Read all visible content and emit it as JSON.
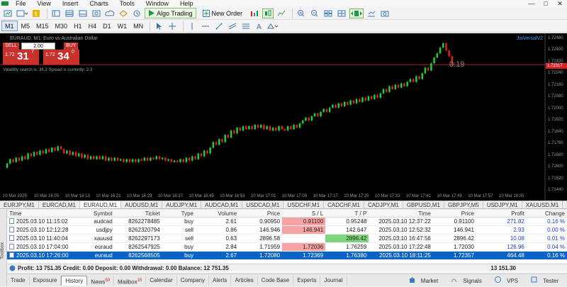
{
  "menu": {
    "items": [
      "File",
      "View",
      "Insert",
      "Charts",
      "Tools",
      "Window",
      "Help"
    ],
    "win_min": "—",
    "win_max": "□",
    "win_close": "✕"
  },
  "toolbar": {
    "algo_label": "Algo Trading",
    "new_order_label": "New Order"
  },
  "timeframes": {
    "items": [
      "M1",
      "M5",
      "M15",
      "M30",
      "H1",
      "H4",
      "D1",
      "W1",
      "MN"
    ],
    "active": "M1"
  },
  "chart": {
    "title": "EURAUD, M1:  Euro vs Australian Dollar",
    "indicator": "JoiVersalV2",
    "sell_label": "SELL",
    "buy_label": "BUY",
    "volume": "2.00",
    "sell_price_prefix": "1.72",
    "sell_price_big": "31",
    "sell_price_sup": "7",
    "buy_price_prefix": "1.72",
    "buy_price_big": "34",
    "buy_price_sup": "0",
    "info": "Volatility search is: 36.2  Spread is currently: 2.3",
    "countdown": "0:19",
    "current_price": "1.72317",
    "price_labels": [
      "1.72480",
      "1.72400",
      "1.72320",
      "1.72240",
      "1.72160",
      "1.72080",
      "1.72000",
      "1.71920",
      "1.71840",
      "1.71760",
      "1.71680",
      "1.71600",
      "1.71520",
      "1.71440"
    ],
    "time_labels": [
      "10 Mar 2025",
      "10 Mar 16:05",
      "10 Mar 16:13",
      "10 Mar 16:21",
      "10 Mar 16:29",
      "10 Mar 16:37",
      "10 Mar 16:45",
      "10 Mar 16:53",
      "10 Mar 17:01",
      "10 Mar 17:09",
      "10 Mar 17:17",
      "10 Mar 17:25",
      "10 Mar 17:33",
      "10 Mar 17:41",
      "10 Mar 17:49",
      "10 Mar 17:57",
      "10 Mar 18:05"
    ],
    "colors": {
      "bull": "#19d13a",
      "bear": "#e0201c",
      "background": "#000000",
      "bid_line": "#d22020"
    }
  },
  "chart_data": {
    "type": "candlestick",
    "ylim": [
      1.7144,
      1.7252
    ],
    "candles": [
      [
        1.716,
        1.7163
      ],
      [
        1.7163,
        1.7166
      ],
      [
        1.7166,
        1.7164
      ],
      [
        1.7164,
        1.7167
      ],
      [
        1.7167,
        1.7165
      ],
      [
        1.7165,
        1.7168
      ],
      [
        1.7168,
        1.7166
      ],
      [
        1.7166,
        1.717
      ],
      [
        1.717,
        1.7168
      ],
      [
        1.7168,
        1.7171
      ],
      [
        1.7171,
        1.7169
      ],
      [
        1.7169,
        1.7172
      ],
      [
        1.7172,
        1.717
      ],
      [
        1.717,
        1.7173
      ],
      [
        1.7173,
        1.7171
      ],
      [
        1.7171,
        1.7174
      ],
      [
        1.7174,
        1.7172
      ],
      [
        1.7172,
        1.7175
      ],
      [
        1.7175,
        1.7173
      ],
      [
        1.7173,
        1.717
      ],
      [
        1.717,
        1.7172
      ],
      [
        1.7172,
        1.7169
      ],
      [
        1.7169,
        1.7171
      ],
      [
        1.7171,
        1.7168
      ],
      [
        1.7168,
        1.717
      ],
      [
        1.717,
        1.7167
      ],
      [
        1.7167,
        1.7169
      ],
      [
        1.7169,
        1.7166
      ],
      [
        1.7166,
        1.7168
      ],
      [
        1.7168,
        1.7166
      ],
      [
        1.7166,
        1.7168
      ],
      [
        1.7168,
        1.7166
      ],
      [
        1.7166,
        1.7168
      ],
      [
        1.7168,
        1.7165
      ],
      [
        1.7165,
        1.7167
      ],
      [
        1.7167,
        1.7165
      ],
      [
        1.7165,
        1.7167
      ],
      [
        1.7167,
        1.7165
      ],
      [
        1.7165,
        1.7166
      ],
      [
        1.7166,
        1.7164
      ],
      [
        1.7164,
        1.7166
      ],
      [
        1.7166,
        1.7164
      ],
      [
        1.7164,
        1.7166
      ],
      [
        1.7166,
        1.7164
      ],
      [
        1.7164,
        1.7166
      ],
      [
        1.7166,
        1.7165
      ],
      [
        1.7165,
        1.7167
      ],
      [
        1.7167,
        1.7165
      ],
      [
        1.7165,
        1.7167
      ],
      [
        1.7167,
        1.7166
      ],
      [
        1.7166,
        1.7168
      ],
      [
        1.7168,
        1.7166
      ],
      [
        1.7166,
        1.7167
      ],
      [
        1.7167,
        1.7165
      ],
      [
        1.7165,
        1.7166
      ],
      [
        1.7166,
        1.7164
      ],
      [
        1.7164,
        1.7165
      ],
      [
        1.7165,
        1.7164
      ],
      [
        1.7164,
        1.7166
      ],
      [
        1.7166,
        1.7164
      ],
      [
        1.7164,
        1.7167
      ],
      [
        1.7167,
        1.7165
      ],
      [
        1.7165,
        1.7168
      ],
      [
        1.7168,
        1.7166
      ],
      [
        1.7166,
        1.717
      ],
      [
        1.717,
        1.7168
      ],
      [
        1.7168,
        1.7172
      ],
      [
        1.7172,
        1.717
      ],
      [
        1.717,
        1.7174
      ],
      [
        1.7174,
        1.7178
      ],
      [
        1.7178,
        1.7176
      ],
      [
        1.7176,
        1.718
      ],
      [
        1.718,
        1.7178
      ],
      [
        1.7178,
        1.7183
      ],
      [
        1.7183,
        1.7181
      ],
      [
        1.7181,
        1.7186
      ],
      [
        1.7186,
        1.7184
      ],
      [
        1.7184,
        1.7188
      ],
      [
        1.7188,
        1.7186
      ],
      [
        1.7186,
        1.7189
      ],
      [
        1.7189,
        1.7187
      ],
      [
        1.7187,
        1.7189
      ],
      [
        1.7189,
        1.7187
      ],
      [
        1.7187,
        1.719
      ],
      [
        1.719,
        1.7188
      ],
      [
        1.7188,
        1.719
      ],
      [
        1.719,
        1.7187
      ],
      [
        1.7187,
        1.7189
      ],
      [
        1.7189,
        1.7186
      ],
      [
        1.7186,
        1.7188
      ],
      [
        1.7188,
        1.7186
      ],
      [
        1.7186,
        1.7189
      ],
      [
        1.7189,
        1.7187
      ],
      [
        1.7187,
        1.7186
      ],
      [
        1.7186,
        1.7189
      ],
      [
        1.7189,
        1.7187
      ],
      [
        1.7187,
        1.719
      ],
      [
        1.719,
        1.7188
      ],
      [
        1.7188,
        1.7191
      ],
      [
        1.7191,
        1.7193
      ],
      [
        1.7193,
        1.7195
      ],
      [
        1.7195,
        1.7193
      ],
      [
        1.7193,
        1.7196
      ],
      [
        1.7196,
        1.7198
      ],
      [
        1.7198,
        1.7196
      ],
      [
        1.7196,
        1.7199
      ],
      [
        1.7199,
        1.7201
      ],
      [
        1.7201,
        1.7199
      ],
      [
        1.7199,
        1.7202
      ],
      [
        1.7202,
        1.7204
      ],
      [
        1.7204,
        1.7202
      ],
      [
        1.7202,
        1.7205
      ],
      [
        1.7205,
        1.7203
      ],
      [
        1.7203,
        1.7206
      ],
      [
        1.7206,
        1.7204
      ],
      [
        1.7204,
        1.7207
      ],
      [
        1.7207,
        1.7205
      ],
      [
        1.7205,
        1.7208
      ],
      [
        1.7208,
        1.7206
      ],
      [
        1.7206,
        1.7209
      ],
      [
        1.7209,
        1.7207
      ],
      [
        1.7207,
        1.721
      ],
      [
        1.721,
        1.7208
      ],
      [
        1.7208,
        1.7211
      ],
      [
        1.7211,
        1.7209
      ],
      [
        1.7209,
        1.7212
      ],
      [
        1.7212,
        1.7215
      ],
      [
        1.7215,
        1.7213
      ],
      [
        1.7213,
        1.7217
      ],
      [
        1.7217,
        1.7215
      ],
      [
        1.7215,
        1.7218
      ],
      [
        1.7218,
        1.7216
      ],
      [
        1.7216,
        1.7219
      ],
      [
        1.7219,
        1.7217
      ],
      [
        1.7217,
        1.722
      ],
      [
        1.722,
        1.7222
      ],
      [
        1.7222,
        1.722
      ],
      [
        1.722,
        1.7224
      ],
      [
        1.7224,
        1.7222
      ],
      [
        1.7222,
        1.7226
      ],
      [
        1.7226,
        1.723
      ],
      [
        1.723,
        1.7228
      ],
      [
        1.7228,
        1.7233
      ],
      [
        1.7233,
        1.7237
      ],
      [
        1.7237,
        1.724
      ],
      [
        1.724,
        1.7244
      ],
      [
        1.7244,
        1.7247
      ],
      [
        1.7247,
        1.7242
      ],
      [
        1.7242,
        1.7238
      ],
      [
        1.7238,
        1.7232
      ]
    ]
  },
  "symbol_tabs": {
    "items": [
      "EURJPY,M1",
      "EURCAD,M1",
      "EURAUD,M1",
      "AUDUSD,M1",
      "AUDJPY,M1",
      "AUDCAD,M1",
      "USDCAD,M1",
      "USDCHF,M1",
      "CADCHF,M1",
      "CADJPY,M1",
      "GBPUSD,M1",
      "GBPJPY,M5",
      "USDJPY,M1",
      "XAUUSD,M1",
      "XAUEUR,M1"
    ],
    "active": "EURAUD,M1"
  },
  "history": {
    "headers": [
      "Time",
      "Symbol",
      "Ticket",
      "Type",
      "Volume",
      "Price",
      "S / L",
      "T / P",
      "Time",
      "Price",
      "Profit",
      "Change"
    ],
    "rows": [
      [
        "2025.03.10 11:15:02",
        "audcad",
        "8262278485",
        "buy",
        "2.61",
        "0.90950",
        "0.91100",
        "0.95248",
        "2025.03.10 12:37:22",
        "0.91100",
        "271.82",
        "0.16 %"
      ],
      [
        "2025.03.10 12:12:28",
        "usdjpy",
        "8262320794",
        "sell",
        "0.86",
        "146.946",
        "146.941",
        "142.647",
        "2025.03.10 12:52:32",
        "146.941",
        "2.93",
        "0.00 %"
      ],
      [
        "2025.03.10 11:40:04",
        "xauusd",
        "8262297173",
        "sell",
        "0.63",
        "2896.58",
        "",
        "2896.42",
        "2025.03.10 16:47:56",
        "2896.42",
        "10.08",
        "0.01 %"
      ],
      [
        "2025.03.10 17:04:00",
        "euraud",
        "8262547925",
        "buy",
        "2.84",
        "1.71959",
        "1.72036",
        "1.76259",
        "2025.03.10 17:22:48",
        "1.72030",
        "126.96",
        "0.04 %"
      ],
      [
        "2025.03.10 17:26:00",
        "euraud",
        "8262568505",
        "buy",
        "2.67",
        "1.72080",
        "1.72369",
        "1.76380",
        "2025.03.10 18:11:25",
        "1.72357",
        "464.48",
        "0.16 %"
      ]
    ],
    "summary": "Profit: 13 751.35  Credit: 0.00  Deposit: 0.00  Withdrawal: 0.00  Balance: 12 751.35",
    "summary_total": "13 151.30"
  },
  "toolbox_label": "Toolbox",
  "bottom_tabs": {
    "items": [
      "Trade",
      "Exposure",
      "History",
      "News",
      "Mailbox",
      "Calendar",
      "Company",
      "Alerts",
      "Articles",
      "Code Base",
      "Experts",
      "Journal"
    ],
    "active": "History",
    "news_badge": "50",
    "mailbox_badge": "15",
    "market_label": "Market",
    "signals_label": "Signals",
    "vps_label": "VPS",
    "tester_label": "Tester"
  }
}
